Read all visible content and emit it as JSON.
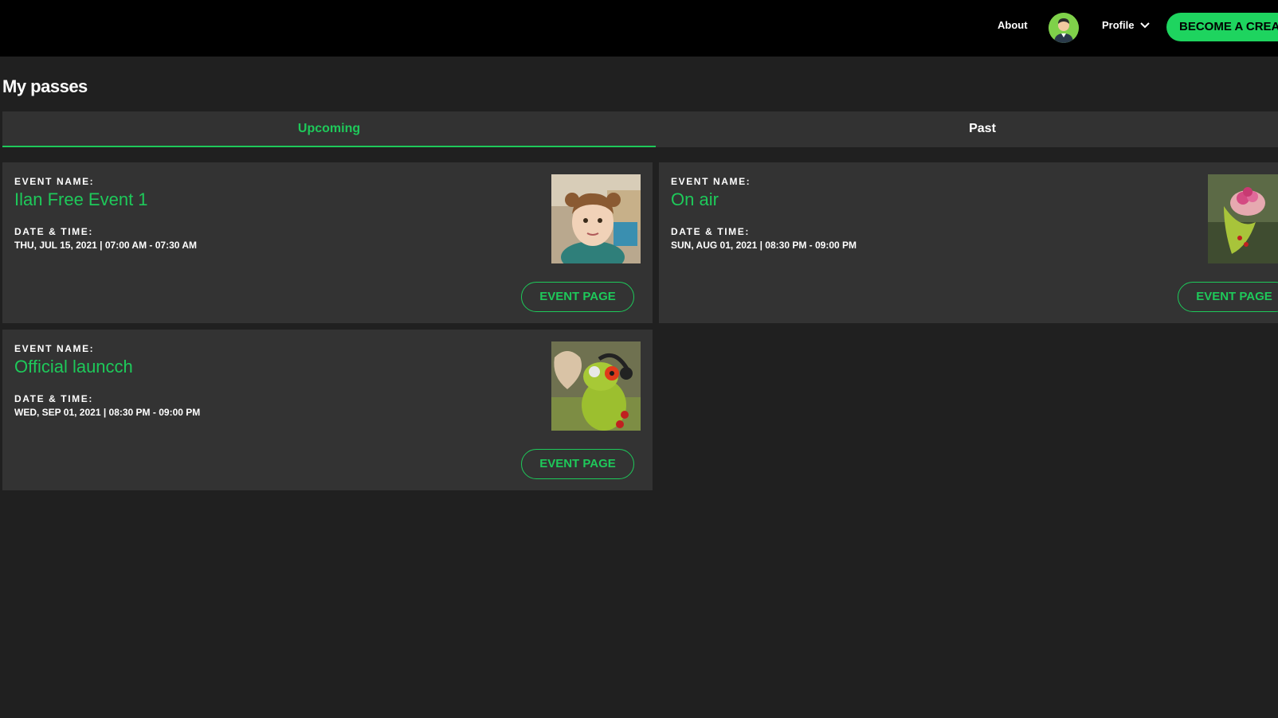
{
  "nav": {
    "about": "About",
    "profile": "Profile",
    "creator_button": "BECOME A CREATOR"
  },
  "page": {
    "title": "My passes"
  },
  "tabs": [
    {
      "label": "Upcoming",
      "active": true
    },
    {
      "label": "Past",
      "active": false
    }
  ],
  "labels": {
    "event_name": "EVENT NAME:",
    "date_time": "DATE & TIME:",
    "event_page": "EVENT PAGE"
  },
  "events": [
    {
      "name": "Ilan Free Event 1",
      "datetime": "THU, JUL 15, 2021 | 07:00 AM - 07:30 AM",
      "thumb": "child-photo"
    },
    {
      "name": "On air",
      "datetime": "SUN, AUG 01, 2021 | 08:30 PM - 09:00 PM",
      "thumb": "frog-flower-photo"
    },
    {
      "name": "Official launcch",
      "datetime": "WED, SEP 01, 2021 | 08:30 PM - 09:00 PM",
      "thumb": "frog-headphones-photo"
    }
  ],
  "colors": {
    "accent": "#1ec95a",
    "background": "#202020",
    "card": "#333333",
    "topbar": "#000000"
  }
}
